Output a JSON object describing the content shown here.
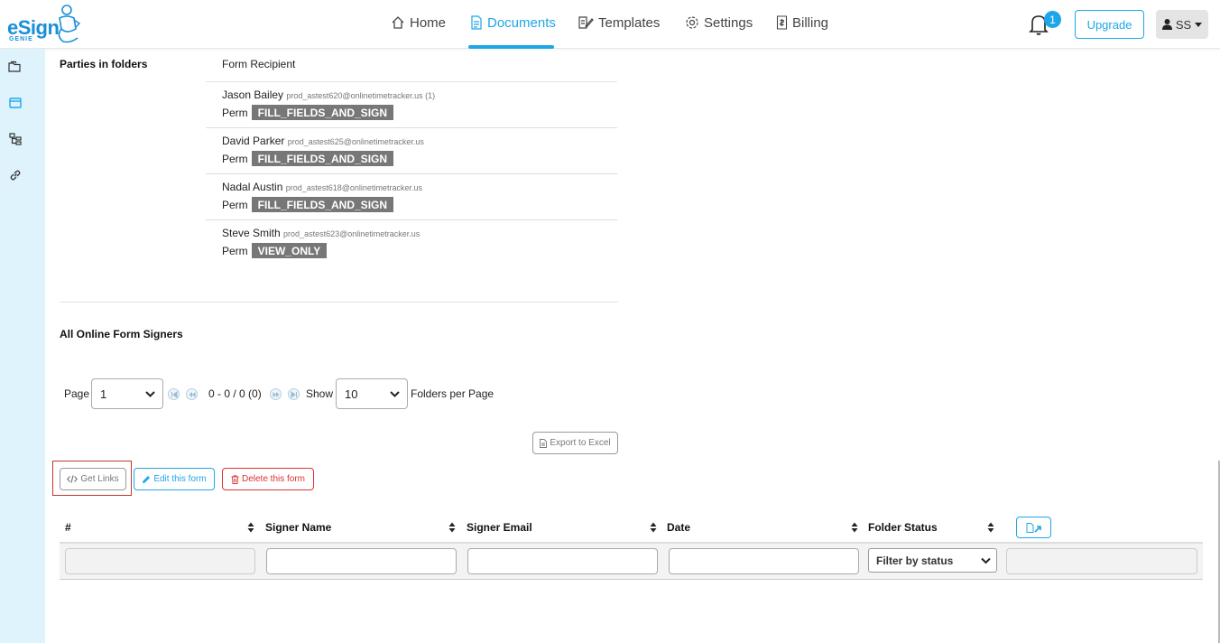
{
  "header": {
    "logo_text": "eSign",
    "logo_sub": "GENIE",
    "nav": [
      {
        "label": "Home",
        "icon": "home-icon"
      },
      {
        "label": "Documents",
        "icon": "document-icon"
      },
      {
        "label": "Templates",
        "icon": "template-icon"
      },
      {
        "label": "Settings",
        "icon": "gear-icon"
      },
      {
        "label": "Billing",
        "icon": "billing-icon"
      }
    ],
    "notification_count": "1",
    "upgrade_label": "Upgrade",
    "user_initials": "SS"
  },
  "colors": {
    "accent": "#1ea7e8",
    "sidebar": "#def3fb",
    "danger": "#dd3333",
    "tag": "#777777"
  },
  "parties": {
    "label": "Parties in folders",
    "column_header": "Form Recipient",
    "perm_label": "Perm",
    "items": [
      {
        "name": "Jason Bailey",
        "email": "prod_astest620@onlinetimetracker.us (1)",
        "perm": "FILL_FIELDS_AND_SIGN"
      },
      {
        "name": "David Parker",
        "email": "prod_astest625@onlinetimetracker.us",
        "perm": "FILL_FIELDS_AND_SIGN"
      },
      {
        "name": "Nadal Austin",
        "email": "prod_astest618@onlinetimetracker.us",
        "perm": "FILL_FIELDS_AND_SIGN"
      },
      {
        "name": "Steve Smith",
        "email": "prod_astest623@onlinetimetracker.us",
        "perm": "VIEW_ONLY"
      }
    ]
  },
  "signers": {
    "title": "All Online Form Signers",
    "page_label": "Page",
    "page_value": "1",
    "range_text": "0 - 0 / 0 (0)",
    "show_label": "Show",
    "per_page_value": "10",
    "per_page_suffix": "Folders per Page",
    "export_label": "Export to Excel",
    "get_links_label": "Get Links",
    "edit_label": "Edit this form",
    "delete_label": "Delete this form"
  },
  "table": {
    "columns": [
      "#",
      "Signer Name",
      "Signer Email",
      "Date",
      "Folder Status"
    ],
    "status_filter_placeholder": "Filter by status"
  }
}
